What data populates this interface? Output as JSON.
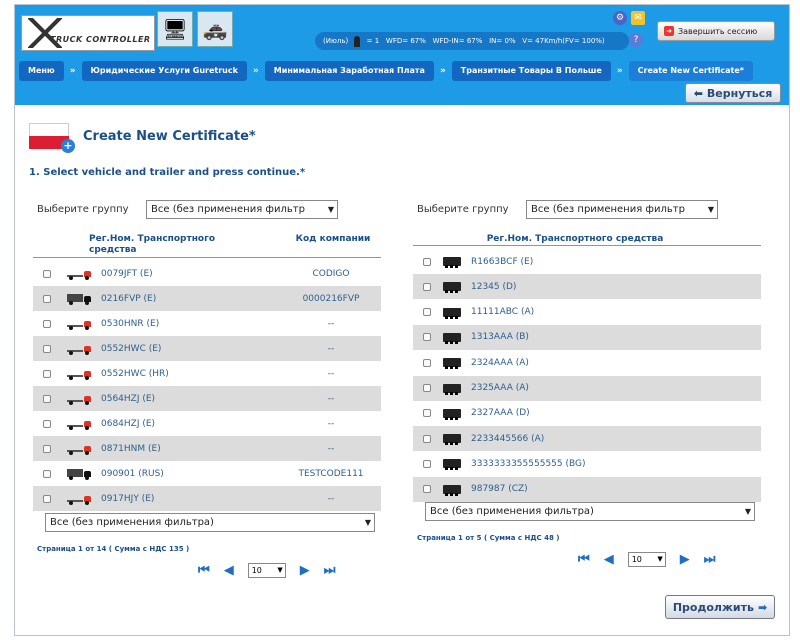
{
  "header": {
    "logo_text": "TRUCK CONTROLLER",
    "status": {
      "month": "(Июль)",
      "count": "= 1",
      "wfd": "WFD= 67%",
      "wfd_in": "WFD-IN= 67%",
      "in": "IN= 0%",
      "v": "V= 47Km/h(FV= 100%)"
    },
    "logout_label": "Завершить сессию",
    "back_label": "Вернуться"
  },
  "breadcrumbs": [
    "Меню",
    "Юридические Услуги Guretruck",
    "Минимальная Заработная Плата",
    "Транзитные Товары В Польше",
    "Create New Certificate*"
  ],
  "page": {
    "title": "Create New Certificate*",
    "step": "1. Select vehicle and trailer and press continue.*",
    "continue_label": "Продолжить"
  },
  "left": {
    "group_label": "Выберите группу",
    "group_value": "Все (без применения фильтр",
    "col_plate": "Рег.Ном. Транспортного средства",
    "col_code": "Код компании",
    "rows": [
      {
        "plate": "0079JFT (E)",
        "code": "CODIGO",
        "icon": "truck-red-icon"
      },
      {
        "plate": "0216FVP (E)",
        "code": "0000216FVP",
        "icon": "truck-black-icon"
      },
      {
        "plate": "0530HNR (E)",
        "code": "--",
        "icon": "truck-red-icon"
      },
      {
        "plate": "0552HWC (E)",
        "code": "--",
        "icon": "truck-red-icon"
      },
      {
        "plate": "0552HWC (HR)",
        "code": "--",
        "icon": "truck-red-icon"
      },
      {
        "plate": "0564HZJ (E)",
        "code": "--",
        "icon": "truck-red-icon"
      },
      {
        "plate": "0684HZJ (E)",
        "code": "--",
        "icon": "truck-red-icon"
      },
      {
        "plate": "0871HNM (E)",
        "code": "--",
        "icon": "truck-red-icon"
      },
      {
        "plate": "090901 (RUS)",
        "code": "TESTCODE111",
        "icon": "truck-black-icon"
      },
      {
        "plate": "0917HJY (E)",
        "code": "--",
        "icon": "truck-red-icon"
      }
    ],
    "filter_value": "Все (без применения фильтра)",
    "page_info": "Страница 1   от   14   ( Сумма с НДС 135 )",
    "page_size": "10"
  },
  "right": {
    "group_label": "Выберите группу",
    "group_value": "Все (без применения фильтр",
    "col_plate": "Рег.Ном. Транспортного средства",
    "rows": [
      {
        "plate": "R1663BCF (E)"
      },
      {
        "plate": "12345 (D)"
      },
      {
        "plate": "11111ABC (A)"
      },
      {
        "plate": "1313AAA (B)"
      },
      {
        "plate": "2324AAA (A)"
      },
      {
        "plate": "2325AAA (A)"
      },
      {
        "plate": "2327AAA (D)"
      },
      {
        "plate": "2233445566 (A)"
      },
      {
        "plate": "3333333355555555 (BG)"
      },
      {
        "plate": "987987 (CZ)"
      }
    ],
    "filter_value": "Все (без применения фильтра)",
    "page_info": "Страница 1   от   5   ( Сумма с НДС 48 )",
    "page_size": "10"
  }
}
